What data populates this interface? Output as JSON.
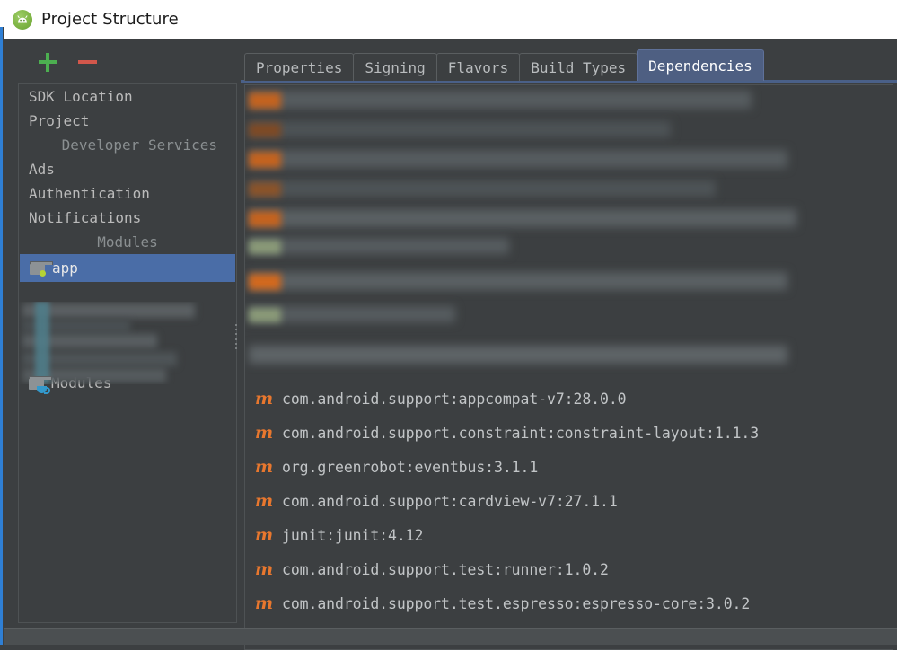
{
  "window": {
    "title": "Project Structure",
    "icon": "android-studio-icon",
    "accent_border": "#2f7fd4"
  },
  "sidebar": {
    "toolbar": {
      "add_label": "+",
      "add_icon": "plus-icon",
      "add_color": "#4caf50",
      "remove_label": "−",
      "remove_icon": "minus-icon",
      "remove_color": "#d2574b"
    },
    "items": [
      {
        "type": "item",
        "label": "SDK Location",
        "name": "sdk-location"
      },
      {
        "type": "item",
        "label": "Project",
        "name": "project"
      },
      {
        "type": "section",
        "label": "Developer Services",
        "name": "developer-services"
      },
      {
        "type": "item",
        "label": "Ads",
        "name": "ads"
      },
      {
        "type": "item",
        "label": "Authentication",
        "name": "authentication"
      },
      {
        "type": "item",
        "label": "Notifications",
        "name": "notifications"
      },
      {
        "type": "section",
        "label": "Modules",
        "name": "modules"
      },
      {
        "type": "module",
        "label": "app",
        "name": "app",
        "selected": true,
        "icon": "folder-icon"
      },
      {
        "type": "module",
        "label": "Modules",
        "name": "modules-node",
        "selected": false,
        "icon": "folder-java-icon"
      }
    ],
    "selection_color": "#4a6da7",
    "redacted_note": "blurred region"
  },
  "main": {
    "tabs": [
      {
        "label": "Properties",
        "name": "properties",
        "active": false
      },
      {
        "label": "Signing",
        "name": "signing",
        "active": false
      },
      {
        "label": "Flavors",
        "name": "flavors",
        "active": false
      },
      {
        "label": "Build Types",
        "name": "build-types",
        "active": false
      },
      {
        "label": "Dependencies",
        "name": "dependencies",
        "active": true
      }
    ],
    "active_tab_color": "#4e5f82",
    "dependencies": [
      {
        "icon": "maven-icon",
        "glyph": "m",
        "label": "com.android.support:appcompat-v7:28.0.0"
      },
      {
        "icon": "maven-icon",
        "glyph": "m",
        "label": "com.android.support.constraint:constraint-layout:1.1.3"
      },
      {
        "icon": "maven-icon",
        "glyph": "m",
        "label": "org.greenrobot:eventbus:3.1.1"
      },
      {
        "icon": "maven-icon",
        "glyph": "m",
        "label": "com.android.support:cardview-v7:27.1.1"
      },
      {
        "icon": "maven-icon",
        "glyph": "m",
        "label": "junit:junit:4.12"
      },
      {
        "icon": "maven-icon",
        "glyph": "m",
        "label": "com.android.support.test:runner:1.0.2"
      },
      {
        "icon": "maven-icon",
        "glyph": "m",
        "label": "com.android.support.test.espresso:espresso-core:3.0.2"
      }
    ],
    "maven_icon_color": "#e8772e",
    "redacted_note": "blurred rows above the readable dependency list"
  }
}
